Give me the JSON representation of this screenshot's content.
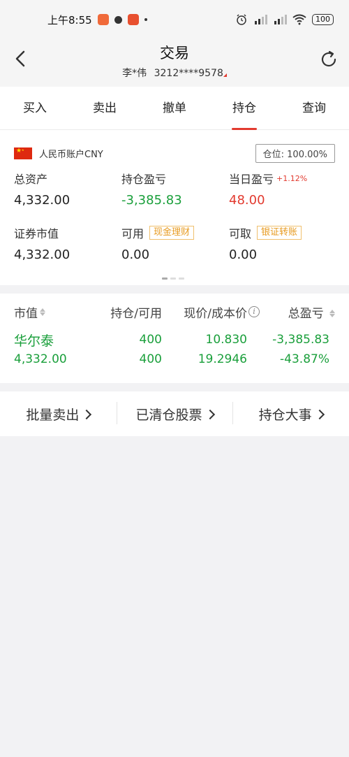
{
  "status_bar": {
    "time": "上午8:55",
    "battery": "100"
  },
  "header": {
    "title": "交易",
    "account_name": "李*伟",
    "account_number": "3212****9578"
  },
  "tabs": [
    {
      "label": "买入",
      "active": false
    },
    {
      "label": "卖出",
      "active": false
    },
    {
      "label": "撤单",
      "active": false
    },
    {
      "label": "持仓",
      "active": true
    },
    {
      "label": "查询",
      "active": false
    }
  ],
  "account": {
    "label": "人民币账户CNY",
    "position": "仓位: 100.00%",
    "total_assets_label": "总资产",
    "total_assets": "4,332.00",
    "holding_pl_label": "持仓盈亏",
    "holding_pl": "-3,385.83",
    "daily_pl_label": "当日盈亏",
    "daily_pl_pct": "+1.12%",
    "daily_pl": "48.00",
    "market_value_label": "证券市值",
    "market_value": "4,332.00",
    "available_label": "可用",
    "available_tag": "现金理财",
    "available": "0.00",
    "withdrawable_label": "可取",
    "withdrawable_tag": "银证转账",
    "withdrawable": "0.00"
  },
  "holdings": {
    "headers": {
      "market_value": "市值",
      "position": "持仓/可用",
      "price": "现价/成本价",
      "total_pl": "总盈亏"
    },
    "rows": [
      {
        "name": "华尔泰",
        "market_value": "4,332.00",
        "position": "400",
        "available": "400",
        "current_price": "10.830",
        "cost_price": "19.2946",
        "total_pl": "-3,385.83",
        "total_pl_pct": "-43.87%"
      }
    ]
  },
  "actions": [
    {
      "label": "批量卖出"
    },
    {
      "label": "已清仓股票"
    },
    {
      "label": "持仓大事"
    }
  ],
  "colors": {
    "accent_red": "#e23a2f",
    "loss_green": "#1a9f3b",
    "tag_orange": "#e79a1f"
  }
}
